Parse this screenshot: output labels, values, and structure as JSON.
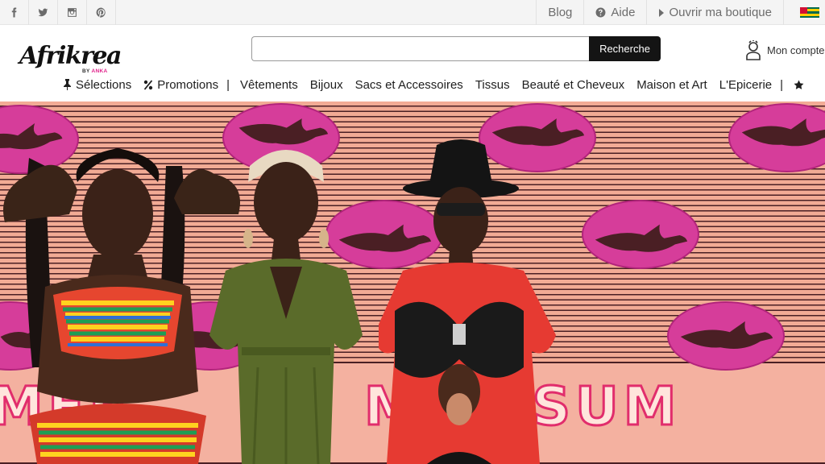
{
  "topbar": {
    "social": [
      {
        "icon": "facebook-icon"
      },
      {
        "icon": "twitter-icon"
      },
      {
        "icon": "instagram-icon"
      },
      {
        "icon": "pinterest-icon"
      }
    ],
    "links": {
      "blog": "Blog",
      "aide": "Aide",
      "ouvrir": "Ouvrir ma boutique"
    },
    "flag": "togo-flag-icon"
  },
  "header": {
    "logo": {
      "main": "Afrikrea",
      "by": "BY",
      "brand": "ANKA"
    },
    "search": {
      "value": "",
      "placeholder": "",
      "button": "Recherche"
    },
    "account_label": "Mon compte"
  },
  "nav": {
    "selections": "Sélections",
    "promotions": "Promotions",
    "vetements": "Vêtements",
    "bijoux": "Bijoux",
    "sacs": "Sacs et Accessoires",
    "tissus": "Tissus",
    "beaute": "Beauté et Cheveux",
    "maison": "Maison et Art",
    "epicerie": "L'Epicerie"
  },
  "hero": {
    "banner_text_left": "MER",
    "banner_text_right": "MER SUM"
  },
  "colors": {
    "brand_pink": "#e0218a",
    "stripe_dark": "#4a1f24",
    "stripe_light": "#f2ab95",
    "oval_pink": "#d63d9a",
    "search_button": "#141414"
  }
}
